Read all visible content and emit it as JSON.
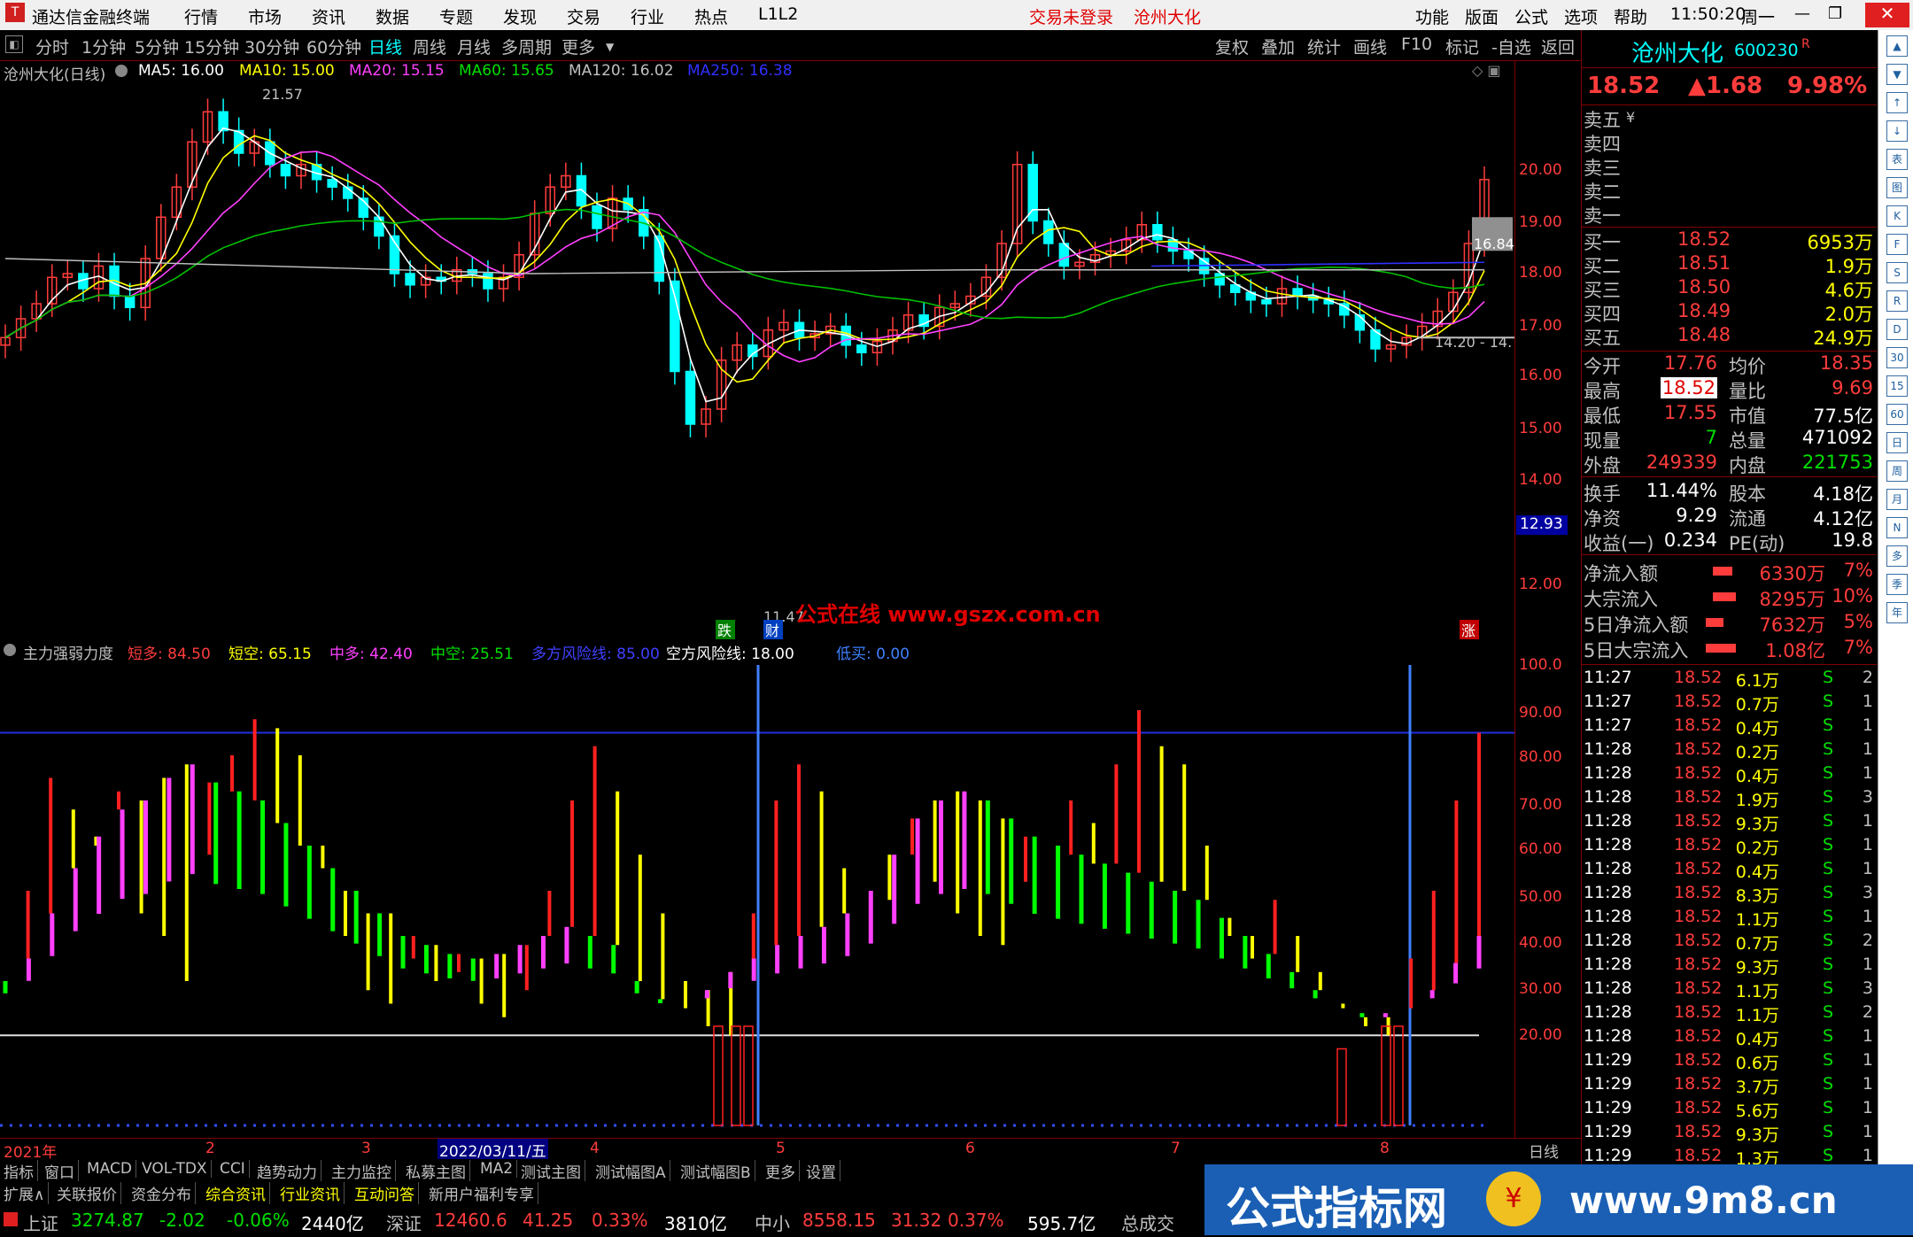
{
  "titlebar": {
    "app_name": "通达信金融终端",
    "menu": [
      "行情",
      "市场",
      "资讯",
      "数据",
      "专题",
      "发现",
      "交易",
      "行业",
      "热点",
      "L1L2"
    ],
    "trade_status": "交易未登录",
    "stock_title": "沧州大化",
    "right_menu": [
      "功能",
      "版面",
      "公式",
      "选项",
      "帮助"
    ],
    "time": "11:50:20",
    "weekday": "周一"
  },
  "periods": [
    "分时",
    "1分钟",
    "5分钟",
    "15分钟",
    "30分钟",
    "60分钟",
    "日线",
    "周线",
    "月线",
    "多周期",
    "更多"
  ],
  "active_period": "日线",
  "chart_tools": [
    "复权",
    "叠加",
    "统计",
    "画线",
    "F10",
    "标记",
    "-自选",
    "返回"
  ],
  "main_legend": {
    "name": "沧州大化(日线)",
    "ma5": "MA5: 16.00",
    "ma10": "MA10: 15.00",
    "ma20": "MA20: 15.15",
    "ma60": "MA60: 15.65",
    "ma120": "MA120: 16.02",
    "ma250": "MA250: 16.38"
  },
  "price_axis": [
    "20.00",
    "19.00",
    "18.00",
    "17.00",
    "16.00",
    "15.00",
    "14.00",
    "12.00"
  ],
  "price_marker": "12.93",
  "annotations": {
    "high": "21.57",
    "low": "11.47",
    "range": "14.20 - 14.",
    "box_price": "16.84",
    "watermark": "公式在线 www.gszx.com.cn",
    "tag_drop": "跌",
    "tag_cai": "财",
    "tag_rise": "涨"
  },
  "sub_legend": {
    "name": "主力强弱力度",
    "short_long": "短多: 84.50",
    "short_short": "短空: 65.15",
    "mid_long": "中多: 42.40",
    "mid_short": "中空: 25.51",
    "long_risk": "多方风险线: 85.00",
    "short_risk": "空方风险线: 18.00",
    "low_buy": "低买: 0.00"
  },
  "sub_axis": [
    "100.0",
    "90.00",
    "80.00",
    "70.00",
    "60.00",
    "50.00",
    "40.00",
    "30.00",
    "20.00"
  ],
  "date_axis": {
    "labels": [
      "2021年",
      "2",
      "3",
      "2022/03/11/五",
      "4",
      "5",
      "6",
      "7",
      "8"
    ],
    "right": "日线"
  },
  "bottom_tabs": [
    "指标",
    "窗口",
    "MACD",
    "VOL-TDX",
    "CCI",
    "趋势动力",
    "主力监控",
    "私募主图",
    "MA2",
    "测试主图",
    "测试幅图A",
    "测试幅图B",
    "更多",
    "设置"
  ],
  "bottom_tabs2": [
    "扩展∧",
    "关联报价",
    "资金分布",
    "综合资讯",
    "行业资讯",
    "互动问答",
    "新用户福利专享"
  ],
  "status": {
    "sh_name": "上证",
    "sh_val": "3274.87",
    "sh_chg": "-2.02",
    "sh_pct": "-0.06%",
    "sh_amt": "2440亿",
    "sz_name": "深证",
    "sz_val": "12460.6",
    "sz_chg": "41.25",
    "sz_pct": "0.33%",
    "sz_amt": "3810亿",
    "zx_name": "中小",
    "zx_val": "8558.15",
    "zx_chg": "31.32",
    "zx_pct": "0.37%",
    "zx_amt": "595.7亿",
    "total": "总成交"
  },
  "quote": {
    "name": "沧州大化",
    "code": "600230",
    "flag": "R",
    "price": "18.52",
    "change": "▲1.68",
    "pct": "9.98%",
    "sell": [
      {
        "label": "卖五",
        "price": "",
        "vol": "",
        "extra": "¥"
      },
      {
        "label": "卖四",
        "price": "",
        "vol": ""
      },
      {
        "label": "卖三",
        "price": "",
        "vol": ""
      },
      {
        "label": "卖二",
        "price": "",
        "vol": ""
      },
      {
        "label": "卖一",
        "price": "",
        "vol": ""
      }
    ],
    "buy": [
      {
        "label": "买一",
        "price": "18.52",
        "vol": "6953万"
      },
      {
        "label": "买二",
        "price": "18.51",
        "vol": "1.9万"
      },
      {
        "label": "买三",
        "price": "18.50",
        "vol": "4.6万"
      },
      {
        "label": "买四",
        "price": "18.49",
        "vol": "2.0万"
      },
      {
        "label": "买五",
        "price": "18.48",
        "vol": "24.9万"
      }
    ],
    "stats": [
      {
        "l1": "今开",
        "v1": "17.76",
        "l2": "均价",
        "v2": "18.35"
      },
      {
        "l1": "最高",
        "v1": "18.52",
        "l2": "量比",
        "v2": "9.69"
      },
      {
        "l1": "最低",
        "v1": "17.55",
        "l2": "市值",
        "v2": "77.5亿"
      },
      {
        "l1": "现量",
        "v1": "7",
        "l2": "总量",
        "v2": "471092"
      },
      {
        "l1": "外盘",
        "v1": "249339",
        "l2": "内盘",
        "v2": "221753"
      }
    ],
    "stats2": [
      {
        "l1": "换手",
        "v1": "11.44%",
        "l2": "股本",
        "v2": "4.18亿"
      },
      {
        "l1": "净资",
        "v1": "9.29",
        "l2": "流通",
        "v2": "4.12亿"
      },
      {
        "l1": "收益(一)",
        "v1": "0.234",
        "l2": "PE(动)",
        "v2": "19.8"
      }
    ],
    "flows": [
      {
        "label": "净流入额",
        "val": "6330万",
        "pct": "7%"
      },
      {
        "label": "大宗流入",
        "val": "8295万",
        "pct": "10%"
      },
      {
        "label": "5日净流入额",
        "val": "7632万",
        "pct": "5%"
      },
      {
        "label": "5日大宗流入",
        "val": "1.08亿",
        "pct": "7%"
      }
    ],
    "ticks": [
      {
        "t": "11:27",
        "p": "18.52",
        "v": "6.1万",
        "s": "S",
        "n": "2"
      },
      {
        "t": "11:27",
        "p": "18.52",
        "v": "0.7万",
        "s": "S",
        "n": "1"
      },
      {
        "t": "11:27",
        "p": "18.52",
        "v": "0.4万",
        "s": "S",
        "n": "1"
      },
      {
        "t": "11:28",
        "p": "18.52",
        "v": "0.2万",
        "s": "S",
        "n": "1"
      },
      {
        "t": "11:28",
        "p": "18.52",
        "v": "0.4万",
        "s": "S",
        "n": "1"
      },
      {
        "t": "11:28",
        "p": "18.52",
        "v": "1.9万",
        "s": "S",
        "n": "3"
      },
      {
        "t": "11:28",
        "p": "18.52",
        "v": "9.3万",
        "s": "S",
        "n": "1"
      },
      {
        "t": "11:28",
        "p": "18.52",
        "v": "0.2万",
        "s": "S",
        "n": "1"
      },
      {
        "t": "11:28",
        "p": "18.52",
        "v": "0.4万",
        "s": "S",
        "n": "1"
      },
      {
        "t": "11:28",
        "p": "18.52",
        "v": "8.3万",
        "s": "S",
        "n": "3"
      },
      {
        "t": "11:28",
        "p": "18.52",
        "v": "1.1万",
        "s": "S",
        "n": "1"
      },
      {
        "t": "11:28",
        "p": "18.52",
        "v": "0.7万",
        "s": "S",
        "n": "2"
      },
      {
        "t": "11:28",
        "p": "18.52",
        "v": "9.3万",
        "s": "S",
        "n": "1"
      },
      {
        "t": "11:28",
        "p": "18.52",
        "v": "1.1万",
        "s": "S",
        "n": "3"
      },
      {
        "t": "11:28",
        "p": "18.52",
        "v": "1.1万",
        "s": "S",
        "n": "2"
      },
      {
        "t": "11:28",
        "p": "18.52",
        "v": "0.4万",
        "s": "S",
        "n": "1"
      },
      {
        "t": "11:29",
        "p": "18.52",
        "v": "0.6万",
        "s": "S",
        "n": "1"
      },
      {
        "t": "11:29",
        "p": "18.52",
        "v": "3.7万",
        "s": "S",
        "n": "1"
      },
      {
        "t": "11:29",
        "p": "18.52",
        "v": "5.6万",
        "s": "S",
        "n": "1"
      },
      {
        "t": "11:29",
        "p": "18.52",
        "v": "9.3万",
        "s": "S",
        "n": "1"
      },
      {
        "t": "11:29",
        "p": "18.52",
        "v": "1.3万",
        "s": "S",
        "n": "1"
      }
    ]
  },
  "side_icons": [
    "▲",
    "▼",
    "↑",
    "↓",
    "表",
    "图",
    "K",
    "F",
    "S",
    "R",
    "D",
    "30",
    "15",
    "60",
    "日",
    "周",
    "月",
    "N",
    "多",
    "季",
    "年"
  ],
  "banner": {
    "text": "公式指标网",
    "url": "www.9m8.cn"
  },
  "colors": {
    "up": "#ff3c3c",
    "down": "#00ffff",
    "magenta": "#ff40ff",
    "green": "#00ff00",
    "yellow": "#ffff00"
  }
}
